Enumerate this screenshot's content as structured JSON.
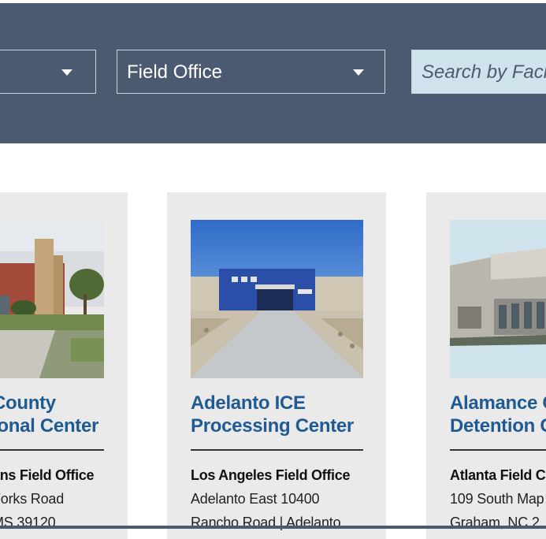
{
  "filters": {
    "state_placeholder": "",
    "field_office_label": "Field Office",
    "search_placeholder": "Search by Faci"
  },
  "facilities": [
    {
      "title": "County\nional Center",
      "field_office": "ans Field Office",
      "address_line1": "Forks Road",
      "address_line2": "MS 39120"
    },
    {
      "title": "Adelanto ICE\nProcessing Center",
      "field_office": "Los Angeles Field Office",
      "address_line1": "Adelanto East 10400",
      "address_line2": "Rancho Road | Adelanto"
    },
    {
      "title": "Alamance C\nDetention C",
      "field_office": "Atlanta Field C",
      "address_line1": "109 South Map",
      "address_line2": "Graham, NC 2"
    }
  ],
  "colors": {
    "header_bg": "#4b5a70",
    "card_bg": "#eaeaea",
    "title_blue": "#1f5a92",
    "search_bg": "#cfe3ec"
  }
}
